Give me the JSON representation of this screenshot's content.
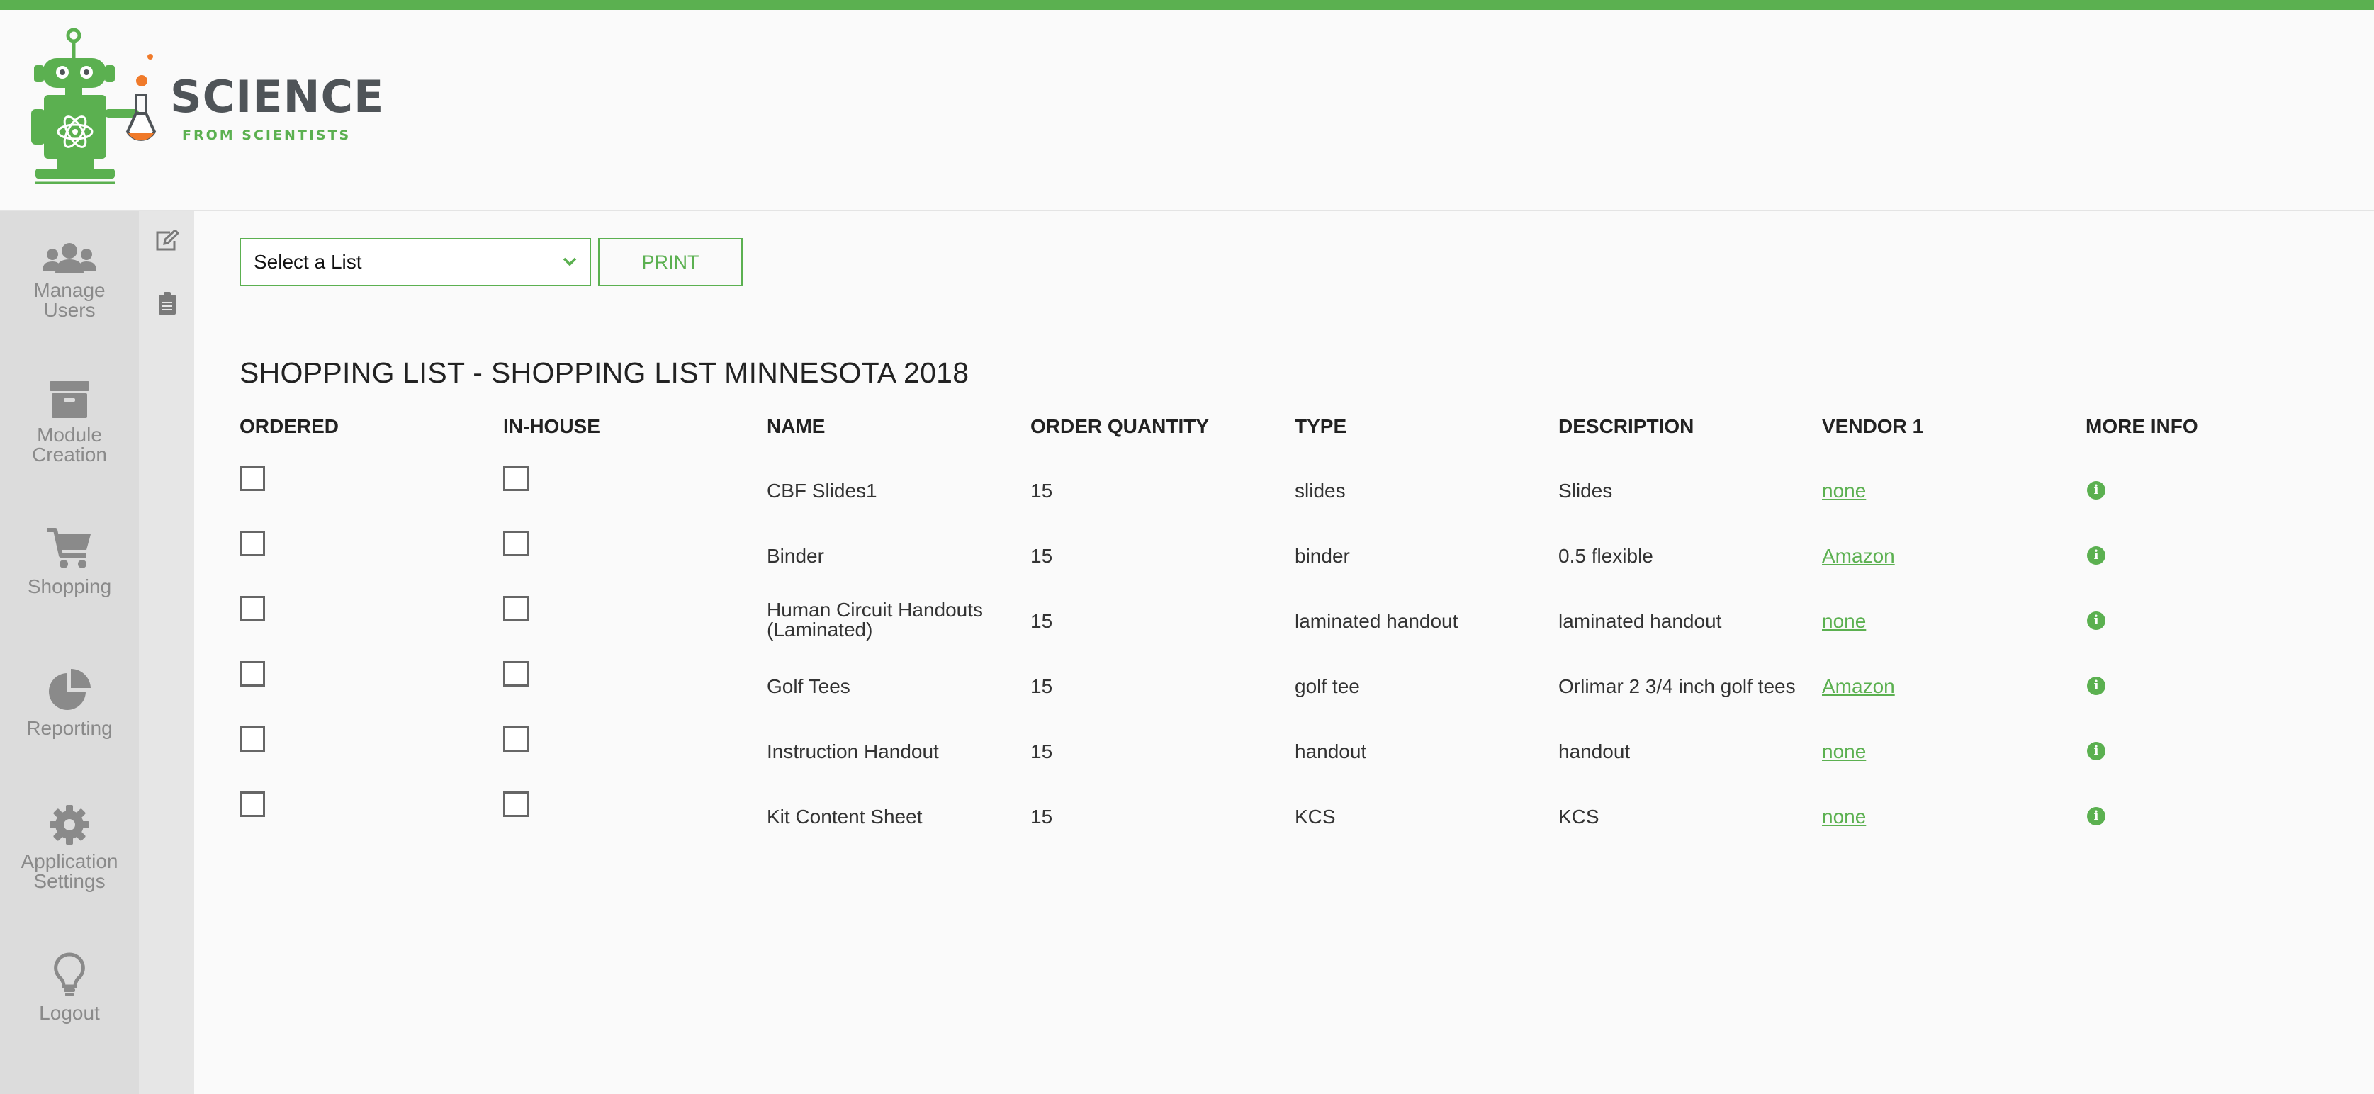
{
  "brand": {
    "title": "SCIENCE",
    "subtitle": "FROM SCIENTISTS",
    "accent_color": "#5bb050"
  },
  "sidebar": {
    "items": [
      {
        "label_line1": "Manage",
        "label_line2": "Users",
        "icon": "users-icon"
      },
      {
        "label_line1": "Module",
        "label_line2": "Creation",
        "icon": "archive-box-icon"
      },
      {
        "label_line1": "Shopping",
        "label_line2": "",
        "icon": "shopping-cart-icon"
      },
      {
        "label_line1": "Reporting",
        "label_line2": "",
        "icon": "pie-chart-icon"
      },
      {
        "label_line1": "Application",
        "label_line2": "Settings",
        "icon": "gear-icon"
      },
      {
        "label_line1": "Logout",
        "label_line2": "",
        "icon": "lightbulb-icon"
      }
    ],
    "sub_icons": [
      "edit-icon",
      "clipboard-icon"
    ]
  },
  "toolbar": {
    "select_value": "Select a List",
    "print_label": "PRINT"
  },
  "list_title": "SHOPPING LIST - SHOPPING LIST MINNESOTA 2018",
  "table": {
    "headers": [
      "ORDERED",
      "IN-HOUSE",
      "NAME",
      "ORDER QUANTITY",
      "TYPE",
      "DESCRIPTION",
      "VENDOR 1",
      "MORE INFO"
    ],
    "rows": [
      {
        "ordered": false,
        "in_house": false,
        "name": "CBF Slides1",
        "quantity": "15",
        "type": "slides",
        "description": "Slides",
        "vendor": "none"
      },
      {
        "ordered": false,
        "in_house": false,
        "name": "Binder",
        "quantity": "15",
        "type": "binder",
        "description": "0.5 flexible",
        "vendor": "Amazon"
      },
      {
        "ordered": false,
        "in_house": false,
        "name": "Human Circuit Handouts (Laminated)",
        "quantity": "15",
        "type": "laminated handout",
        "description": "laminated handout",
        "vendor": "none"
      },
      {
        "ordered": false,
        "in_house": false,
        "name": "Golf Tees",
        "quantity": "15",
        "type": "golf tee",
        "description": "Orlimar 2 3/4 inch golf tees",
        "vendor": "Amazon"
      },
      {
        "ordered": false,
        "in_house": false,
        "name": "Instruction Handout",
        "quantity": "15",
        "type": "handout",
        "description": "handout",
        "vendor": "none"
      },
      {
        "ordered": false,
        "in_house": false,
        "name": "Kit Content Sheet",
        "quantity": "15",
        "type": "KCS",
        "description": "KCS",
        "vendor": "none"
      }
    ]
  }
}
